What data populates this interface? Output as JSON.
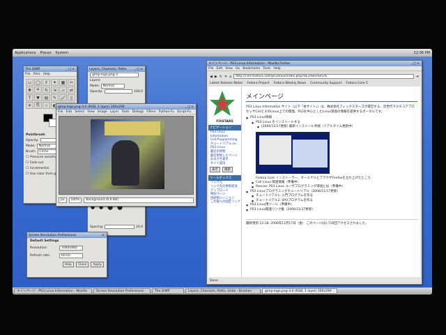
{
  "topbar": {
    "menus": [
      "Applications",
      "Places",
      "System"
    ],
    "clock": "22:36 PM"
  },
  "toolbox": {
    "title": "The GIMP",
    "menus": [
      "File",
      "Xtns",
      "Help"
    ],
    "options_title": "Paintbrush",
    "opacity_label": "Opacity:",
    "opacity_value": "100.0",
    "mode_label": "Mode:",
    "mode_value": "Normal",
    "brush_label": "Brush:",
    "brush_value": "Circle",
    "pressure_label": "Pressure sensitivity",
    "fade_label": "Fade out",
    "incremental_label": "Incremental",
    "color_label": "Use color from gradient"
  },
  "layers": {
    "title": "Layers, Channels, Paths",
    "image_select": "gimp-logo.png-3",
    "label": "Layers",
    "mode_label": "Mode:",
    "mode_value": "Normal",
    "opacity_label": "Opacity:",
    "opacity_value": "100.0",
    "spacing_label": "Spacing:",
    "spacing_value": "20.0"
  },
  "image_window": {
    "title": "gimp-logo.png-3.0 (RGB, 1 layer) 300x290",
    "menus": [
      "File",
      "Edit",
      "Select",
      "View",
      "Image",
      "Layer",
      "Tools",
      "Dialogs",
      "Filters",
      "Python-Fu",
      "Script-Fu"
    ],
    "unit": "px",
    "zoom": "100%",
    "status": "Background (6.6 KB)"
  },
  "dialog": {
    "title": "Screen Resolution Preferences",
    "section": "Default Settings",
    "resolution_label": "Resolution:",
    "resolution_value": "1680x960",
    "refresh_label": "Refresh rate:",
    "refresh_value": "60 Hz",
    "help": "Help",
    "close": "Close",
    "apply": "Apply"
  },
  "firefox": {
    "title": "メインページ - PS3 Linux Information - Mozilla Firefox",
    "menus": [
      "File",
      "Edit",
      "View",
      "Go",
      "Bookmarks",
      "Tools",
      "Help"
    ],
    "url": "http://cell.fixstars.com/ps3linux/index.php/%E3%83%A1%",
    "bookmarks": [
      "Latest Release Notes",
      "Fedora Project",
      "Fedora Weekly News",
      "Community Support",
      "Fedora Core 5"
    ],
    "page_heading": "メインページ",
    "sidebar_title": "FIXSTARS",
    "sidebar_head": "ナビゲーション",
    "sidebar_links": [
      "PS3 Linux Information",
      "Cell Programming チュートリアル on PS3 Linux",
      "最近の更新",
      "最近更新したページ",
      "おまかせ表示",
      "サイト案内"
    ],
    "tools_head": "ツールボックス",
    "tools_links": [
      "リンク元",
      "リンク先の更新状況",
      "アップロード",
      "特別ページ",
      "印刷用バージョン",
      "この版への固定リンク"
    ],
    "search_button": "表示",
    "search_button2": "検索",
    "intro": "PS3 Linux Information サイト（以下「本サイト」）は、株式会社フィックスターズが運営する、次世代マルチコアプロセッサCellとそのLinux上での開発、PS3を中心としたLinux環境の情報を提供するポータルです。",
    "list_items": [
      "PS3 Linux情報",
      "PS3 Linux をインストールする",
      "(2006/11/17更新) 最新インストール手順（リアルタイム更新中）",
      "Fedora Core インストーラー、ターミナルとブラウザFirefoxを立ち上げたところ",
      "Cell Linux 関連情報（準備中）",
      "Roscoe: PS3 Linux ユーザプログラミング環境とは（準備中）",
      "PS3 Linuxプログラミングチュートリアル（2006/11/17更新）",
      "チュートリアル1: 入門プログラムを作る",
      "チュートリアル2: SPUプログラムを作る",
      "PS3 Linux用ツール（準備中）",
      "PS3 Linux関連リンク集（2006/11/17更新）"
    ],
    "footer": "最終更新 12:18, 2006年11月17日（金） このページは1,716回アクセスされました。",
    "status": "Done"
  },
  "taskbar": [
    "メインページ - PS3 Linux Information - Mozilla",
    "Screen Resolution Preferences",
    "The GIMP",
    "Layers, Channels, Paths, Undo - Brushes",
    "gimp-logo.png-3.0 (RGB, 1 layer) 300x290"
  ]
}
